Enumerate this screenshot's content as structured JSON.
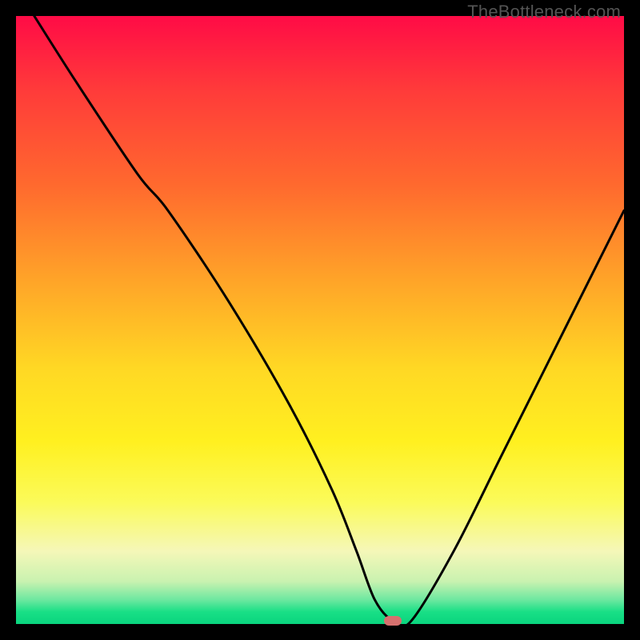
{
  "watermark": "TheBottleneck.com",
  "chart_data": {
    "type": "line",
    "title": "",
    "xlabel": "",
    "ylabel": "",
    "xlim": [
      0,
      100
    ],
    "ylim": [
      0,
      100
    ],
    "grid": false,
    "legend": false,
    "series": [
      {
        "name": "bottleneck-curve",
        "x": [
          3,
          10,
          20,
          25,
          35,
          45,
          52,
          56,
          59,
          62,
          65,
          72,
          80,
          90,
          100
        ],
        "y": [
          100,
          89,
          74,
          68,
          53,
          36,
          22,
          12,
          4,
          0.5,
          0.5,
          12,
          28,
          48,
          68
        ]
      }
    ],
    "marker": {
      "x": 62,
      "y": 0.5
    },
    "colors": {
      "curve": "#000000",
      "marker": "#d6706e",
      "gradient_top": "#ff0b46",
      "gradient_mid": "#ffe424",
      "gradient_bottom": "#0ad47e"
    }
  }
}
